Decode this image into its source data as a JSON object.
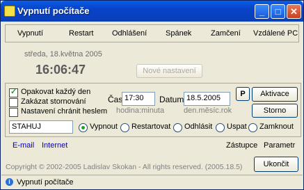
{
  "window": {
    "title": "Vypnutí počítače"
  },
  "titlebar_buttons": {
    "minimize": "_",
    "maximize": "□",
    "close": "✕"
  },
  "menu": [
    "Vypnutí",
    "Restart",
    "Odhlášení",
    "Spánek",
    "Zamčení",
    "Vzdálené PC"
  ],
  "clock": {
    "date": "středa, 18.května 2005",
    "time": "16:06:47"
  },
  "buttons": {
    "new_settings": "Nové nastavení",
    "p": "P",
    "activate": "Aktivace",
    "cancel": "Storno",
    "quit": "Ukončit"
  },
  "options": {
    "repeat_daily": {
      "label": "Opakovat každý den",
      "checked": true
    },
    "forbid_cancel": {
      "label": "Zakázat stornování",
      "checked": false
    },
    "protect_password": {
      "label": "Nastavení chránit heslem",
      "checked": false
    }
  },
  "time_field": {
    "label": "Čas",
    "value": "17:30",
    "hint": "hodina:minuta"
  },
  "date_field": {
    "label": "Datum",
    "value": "18.5.2005",
    "hint": "den.měsíc.rok"
  },
  "command_field": {
    "value": "STAHUJ"
  },
  "actions": {
    "selected": "Vypnout",
    "items": [
      "Vypnout",
      "Restartovat",
      "Odhlásit",
      "Uspat",
      "Zamknout"
    ]
  },
  "links": {
    "email": "E-mail",
    "internet": "Internet",
    "representative": "Zástupce",
    "parameter": "Parametr"
  },
  "copyright": "Copyright © 2002-2005 Ladislav Skokan - All rights reserved. (2005.18.5)",
  "status": {
    "text": "Vypnutí počítače"
  }
}
